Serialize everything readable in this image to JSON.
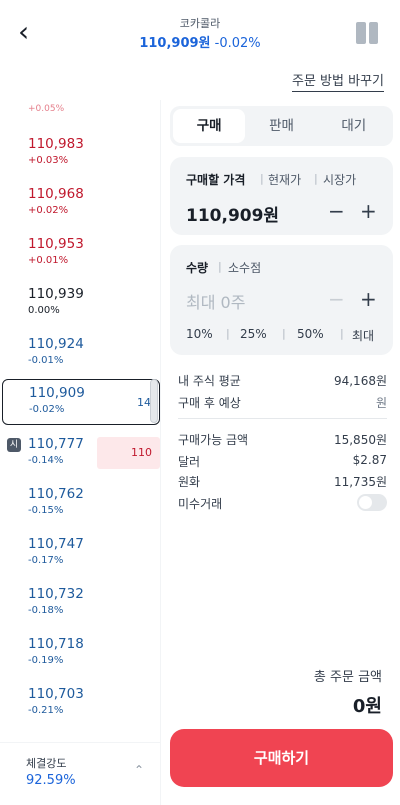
{
  "header": {
    "title": "코카콜라",
    "price": "110,909원",
    "change": "-0.02%"
  },
  "change_method_label": "주문 방법 바꾸기",
  "order_book": {
    "top_partial": "+0.05%",
    "rows": [
      {
        "price": "110,983",
        "rate": "+0.03%",
        "tone": "red"
      },
      {
        "price": "110,968",
        "rate": "+0.02%",
        "tone": "red"
      },
      {
        "price": "110,953",
        "rate": "+0.01%",
        "tone": "red"
      },
      {
        "price": "110,939",
        "rate": "0.00%",
        "tone": "black"
      },
      {
        "price": "110,924",
        "rate": "-0.01%",
        "tone": "blue"
      },
      {
        "price": "110,909",
        "rate": "-0.02%",
        "tone": "blue"
      },
      {
        "price": "110,777",
        "rate": "-0.14%",
        "tone": "blue"
      },
      {
        "price": "110,762",
        "rate": "-0.15%",
        "tone": "blue"
      },
      {
        "price": "110,747",
        "rate": "-0.17%",
        "tone": "blue"
      },
      {
        "price": "110,732",
        "rate": "-0.18%",
        "tone": "blue"
      },
      {
        "price": "110,718",
        "rate": "-0.19%",
        "tone": "blue"
      },
      {
        "price": "110,703",
        "rate": "-0.21%",
        "tone": "blue"
      }
    ],
    "current_qty": "14",
    "sell_qty": "110",
    "si_badge": "시"
  },
  "strength": {
    "label": "체결강도",
    "value": "92.59%"
  },
  "tabs": [
    "구매",
    "판매",
    "대기"
  ],
  "price_card": {
    "types": [
      "구매할 가격",
      "현재가",
      "시장가"
    ],
    "value": "110,909원",
    "minus": "−",
    "plus": "+"
  },
  "qty_card": {
    "types": [
      "수량",
      "소수점"
    ],
    "placeholder": "최대 0주",
    "minus": "−",
    "plus": "+",
    "percents": [
      "10%",
      "25%",
      "50%",
      "최대"
    ]
  },
  "info": {
    "avg_label": "내 주식 평균",
    "avg_value": "94,168원",
    "expect_label": "구매 후 예상",
    "expect_value": "원",
    "available_label": "구매가능 금액",
    "available_value": "15,850원",
    "dollar_label": "달러",
    "dollar_value": "$2.87",
    "won_label": "원화",
    "won_value": "11,735원",
    "unsettled_label": "미수거래"
  },
  "total": {
    "label": "총 주문 금액",
    "value": "0원"
  },
  "buy_button": "구매하기"
}
